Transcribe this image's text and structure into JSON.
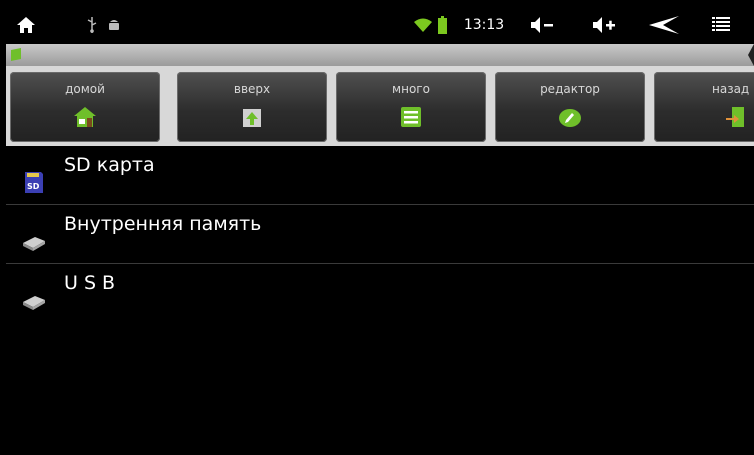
{
  "status_bar": {
    "time": "13:13",
    "icons": [
      "home-icon",
      "usb-icon",
      "android-debug-icon",
      "wifi-icon",
      "battery-icon",
      "volume-down-icon",
      "volume-up-icon",
      "back-icon",
      "menu-icon"
    ],
    "wifi_color": "#7cc81f",
    "battery_color": "#7cc81f"
  },
  "toolbar": {
    "buttons": [
      {
        "label": "домой",
        "icon": "home-icon"
      },
      {
        "label": "вверх",
        "icon": "up-folder-icon"
      },
      {
        "label": "много",
        "icon": "multi-select-icon"
      },
      {
        "label": "редактор",
        "icon": "edit-icon"
      },
      {
        "label": "назад",
        "icon": "back-door-icon"
      }
    ]
  },
  "storage_list": {
    "items": [
      {
        "label": "SD карта",
        "icon": "sd-card-icon"
      },
      {
        "label": "Внутренняя память",
        "icon": "drive-icon"
      },
      {
        "label": "U S B",
        "icon": "drive-icon"
      }
    ]
  },
  "colors": {
    "accent_green": "#6fbf2a",
    "toolbar_bg": "#d8d8d8",
    "pathbar": "#b5b5b5"
  }
}
